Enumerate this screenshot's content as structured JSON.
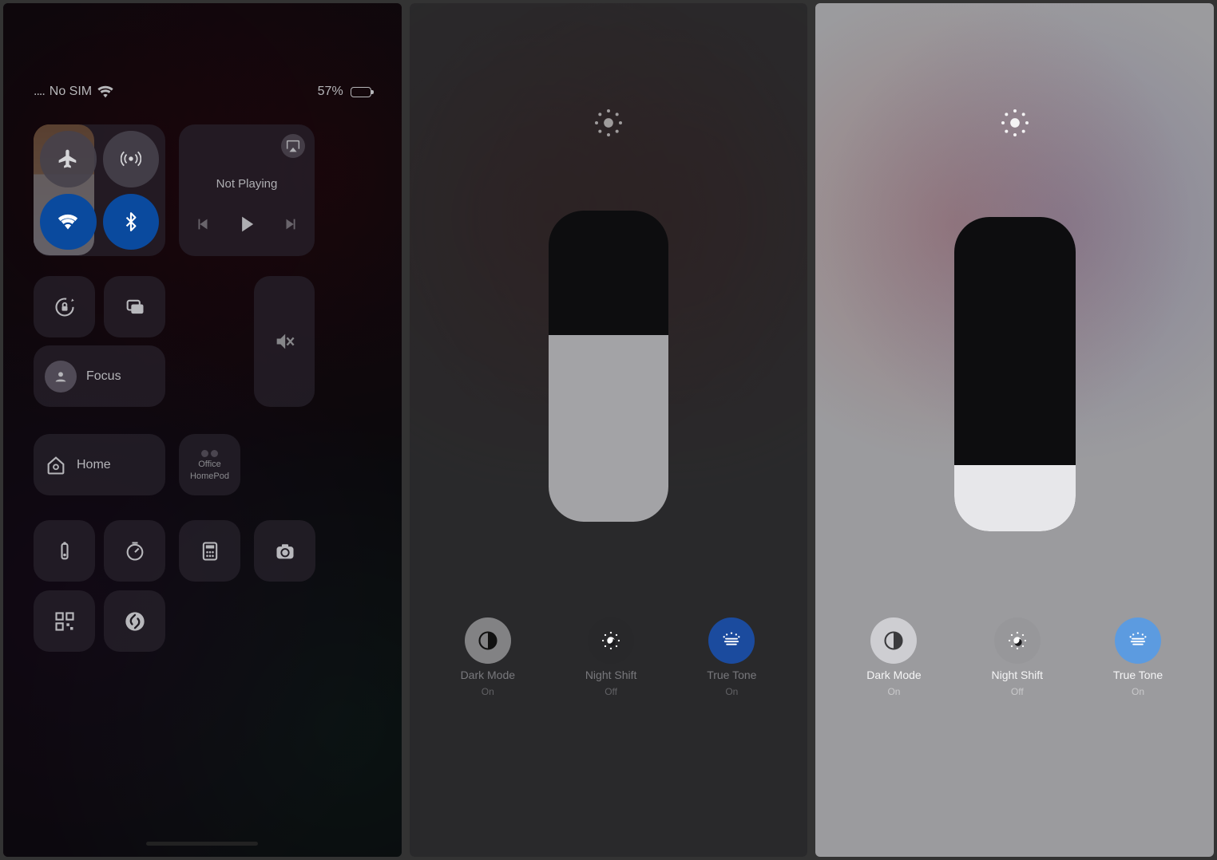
{
  "panel1": {
    "status": {
      "carrier": "No SIM",
      "battery_pct": "57%",
      "battery_fill": 57
    },
    "media": {
      "status": "Not Playing"
    },
    "focus_label": "Focus",
    "home_label": "Home",
    "office": {
      "line1": "Office",
      "line2": "HomePod"
    },
    "brightness_pct": 62
  },
  "panel2": {
    "brightness_pct": 60,
    "modes": {
      "darkmode": {
        "label": "Dark Mode",
        "state": "On"
      },
      "nightshift": {
        "label": "Night Shift",
        "state": "Off"
      },
      "truetone": {
        "label": "True Tone",
        "state": "On"
      }
    }
  },
  "panel3": {
    "brightness_pct": 21,
    "modes": {
      "darkmode": {
        "label": "Dark Mode",
        "state": "On"
      },
      "nightshift": {
        "label": "Night Shift",
        "state": "Off"
      },
      "truetone": {
        "label": "True Tone",
        "state": "On"
      }
    }
  }
}
